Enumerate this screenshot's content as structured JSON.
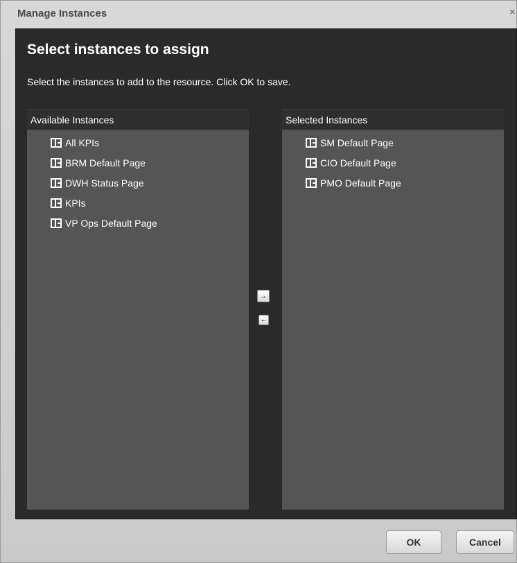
{
  "dialog": {
    "title": "Manage Instances",
    "close_glyph": "×"
  },
  "main": {
    "heading": "Select instances to assign",
    "instruction": "Select the instances to add to the resource. Click OK to save."
  },
  "available": {
    "header": "Available Instances",
    "items": [
      {
        "label": "All KPIs",
        "icon": "page-layout-icon"
      },
      {
        "label": "BRM Default Page",
        "icon": "page-layout-icon"
      },
      {
        "label": "DWH Status Page",
        "icon": "page-layout-icon"
      },
      {
        "label": "KPIs",
        "icon": "page-layout-icon"
      },
      {
        "label": "VP Ops Default Page",
        "icon": "page-layout-icon"
      }
    ]
  },
  "selected": {
    "header": "Selected Instances",
    "items": [
      {
        "label": "SM Default Page",
        "icon": "page-layout-icon"
      },
      {
        "label": "CIO Default Page",
        "icon": "page-layout-icon"
      },
      {
        "label": "PMO Default Page",
        "icon": "page-layout-icon"
      }
    ]
  },
  "transfer": {
    "add_glyph": "→",
    "remove_glyph": "←"
  },
  "buttons": {
    "ok": "OK",
    "cancel": "Cancel"
  }
}
